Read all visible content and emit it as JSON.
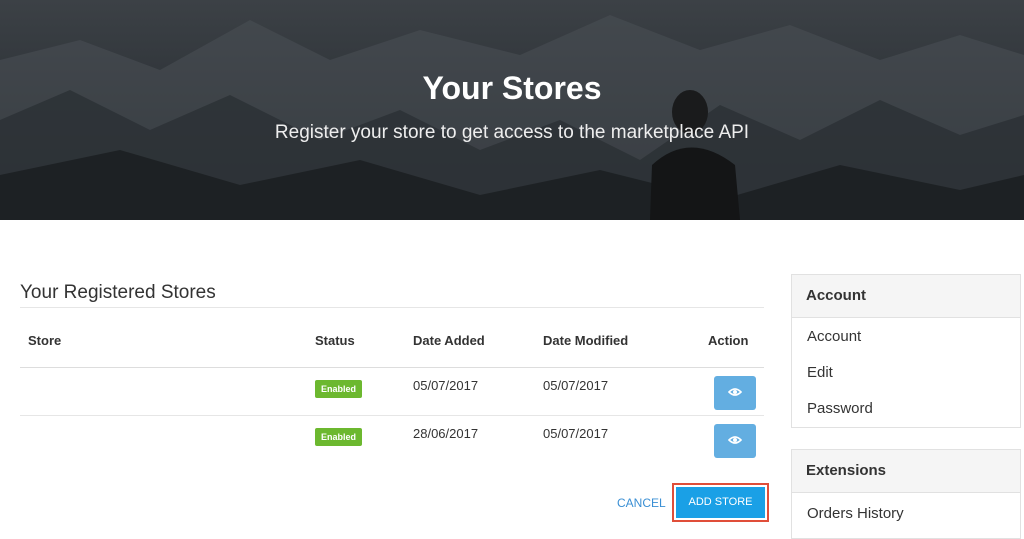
{
  "hero": {
    "title": "Your Stores",
    "subtitle": "Register your store to get access to the marketplace API"
  },
  "main": {
    "section_title": "Your Registered Stores",
    "columns": [
      "Store",
      "Status",
      "Date Added",
      "Date Modified",
      "Action"
    ],
    "rows": [
      {
        "store": "",
        "status": "Enabled",
        "date_added": "05/07/2017",
        "date_modified": "05/07/2017",
        "action_icon": "eye-icon"
      },
      {
        "store": "",
        "status": "Enabled",
        "date_added": "28/06/2017",
        "date_modified": "05/07/2017",
        "action_icon": "eye-icon"
      }
    ],
    "cancel_label": "CANCEL",
    "add_store_label": "ADD STORE"
  },
  "sidebar": {
    "account": {
      "heading": "Account",
      "items": [
        "Account",
        "Edit",
        "Password"
      ]
    },
    "extensions": {
      "heading": "Extensions",
      "items": [
        "Orders History"
      ]
    }
  },
  "colors": {
    "badge_enabled": "#6cb82f",
    "view_button": "#63aee1",
    "add_store_button": "#1aa0e6",
    "highlight_outline": "#e04e39",
    "cancel_link": "#3a8fd4"
  }
}
